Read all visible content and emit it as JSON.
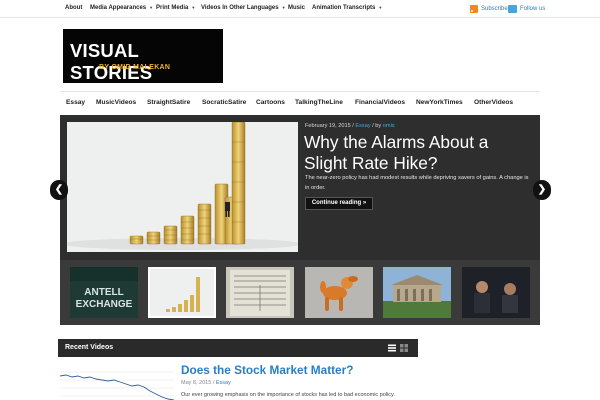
{
  "top_nav": {
    "items": [
      {
        "label": "About",
        "dropdown": false
      },
      {
        "label": "Media Appearances",
        "dropdown": true
      },
      {
        "label": "Print Media",
        "dropdown": true
      },
      {
        "label": "Videos In Other Languages",
        "dropdown": true
      },
      {
        "label": "Music",
        "dropdown": false
      },
      {
        "label": "Animation Transcripts",
        "dropdown": true
      }
    ],
    "caret": "▼",
    "subscribe_label": "Subscribe",
    "follow_label": "Follow us"
  },
  "logo": {
    "title": "VISUAL STORIES",
    "subtitle": "BY OMID MALEKAN"
  },
  "category_nav": [
    "Essay",
    "MusicVideos",
    "StraightSatire",
    "SocraticSatire",
    "Cartoons",
    "TalkingTheLine",
    "FinancialVideos",
    "NewYorkTimes",
    "OtherVideos"
  ],
  "slider": {
    "date": "February 19, 2015",
    "separator": "/",
    "category": "Essay",
    "by": "/ by",
    "author": "omis",
    "title": "Why the Alarms About a Slight Rate Hike?",
    "description": "The near-zero policy has had modest results while depriving savers of gains. A change is in order.",
    "continue_label": "Continue reading »",
    "prev_glyph": "❮",
    "next_glyph": "❯",
    "thumbnail_count": 6
  },
  "recent_videos": {
    "title": "Recent Videos",
    "post": {
      "title": "Does the Stock Market Matter?",
      "date": "May 8, 2015",
      "category": "Essay",
      "excerpt": "Our ever growing emphasis on the importance of stocks has led to bad economic policy."
    }
  },
  "colors": {
    "accent": "#2a7ec1",
    "logo_bg": "#050505",
    "logo_subtitle": "#f0b624",
    "slider_bg": "#2e2e2e",
    "rss": "#f2861f",
    "twitter": "#4aa3df"
  }
}
